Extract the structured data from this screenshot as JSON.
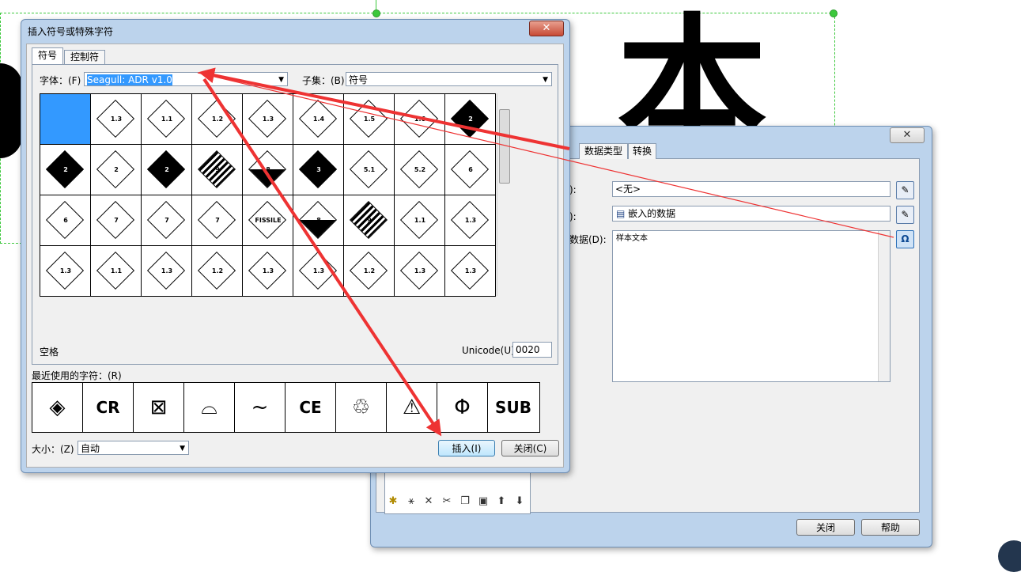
{
  "background": {
    "glyphs": [
      "本"
    ]
  },
  "insert_dialog": {
    "title": "插入符号或特殊字符",
    "close_glyph": "✕",
    "tabs": [
      {
        "label": "符号"
      },
      {
        "label": "控制符"
      }
    ],
    "font_label": "字体：(F)",
    "font_value": "Seagull: ADR v1.0",
    "subset_label": "子集：(B)",
    "subset_value": "符号",
    "grid_cells": [
      {
        "style": "selected",
        "text": ""
      },
      {
        "style": "plain",
        "text": "1.3"
      },
      {
        "style": "plain",
        "text": "1.1"
      },
      {
        "style": "plain",
        "text": "1.2"
      },
      {
        "style": "plain",
        "text": "1.3"
      },
      {
        "style": "plain",
        "text": "1.4"
      },
      {
        "style": "plain",
        "text": "1.5"
      },
      {
        "style": "plain",
        "text": "1.6"
      },
      {
        "style": "dark",
        "text": "2"
      },
      {
        "style": "dark",
        "text": "2"
      },
      {
        "style": "plain",
        "text": "2"
      },
      {
        "style": "dark",
        "text": "2"
      },
      {
        "style": "striped",
        "text": "9"
      },
      {
        "style": "half",
        "text": "8"
      },
      {
        "style": "dark",
        "text": "3"
      },
      {
        "style": "plain",
        "text": "5.1"
      },
      {
        "style": "plain",
        "text": "5.2"
      },
      {
        "style": "plain",
        "text": "6"
      },
      {
        "style": "plain",
        "text": "6"
      },
      {
        "style": "plain",
        "text": "7"
      },
      {
        "style": "plain",
        "text": "7"
      },
      {
        "style": "plain",
        "text": "7"
      },
      {
        "style": "plain",
        "text": "FISSILE"
      },
      {
        "style": "half",
        "text": "8"
      },
      {
        "style": "striped",
        "text": "9"
      },
      {
        "style": "plain",
        "text": "1.1"
      },
      {
        "style": "plain",
        "text": "1.3"
      },
      {
        "style": "plain",
        "text": "1.3"
      },
      {
        "style": "plain",
        "text": "1.1"
      },
      {
        "style": "plain",
        "text": "1.3"
      },
      {
        "style": "plain",
        "text": "1.2"
      },
      {
        "style": "plain",
        "text": "1.3"
      },
      {
        "style": "plain",
        "text": "1.3"
      },
      {
        "style": "plain",
        "text": "1.2"
      },
      {
        "style": "plain",
        "text": "1.3"
      },
      {
        "style": "plain",
        "text": "1.3"
      }
    ],
    "char_name": "空格",
    "unicode_label": "Unicode(U):",
    "unicode_value": "0020",
    "recent_label": "最近使用的字符：(R)",
    "recent_chars": [
      "◈",
      "CR",
      "⊠",
      "⌓",
      "~",
      "CE",
      "♲",
      "⚠",
      "Φ",
      "SUB"
    ],
    "size_label": "大小：(Z)",
    "size_value": "自动",
    "insert_button": "插入(I)",
    "close_button": "关闭(C)"
  },
  "prop_dialog": {
    "close_glyph": "✕",
    "tabs": [
      {
        "label": "数据类型"
      },
      {
        "label": "转换"
      }
    ],
    "row1_label": "):",
    "row1_value": "<无>",
    "row2_label": "):",
    "row2_value": "嵌入的数据",
    "row3_label": "数据(D):",
    "data_text": "样本文本",
    "omega_glyph": "Ω",
    "toolbar_icons": [
      "new-icon",
      "wand-icon",
      "delete-icon",
      "cut-icon",
      "copy-icon",
      "paste-icon",
      "up-arrow-icon",
      "down-arrow-icon"
    ],
    "close_button": "关闭",
    "help_button": "帮助"
  },
  "colors": {
    "annotation_arrow": "#ee3333",
    "selection_blue": "#3399ff",
    "guide_green": "#3cc83c"
  }
}
